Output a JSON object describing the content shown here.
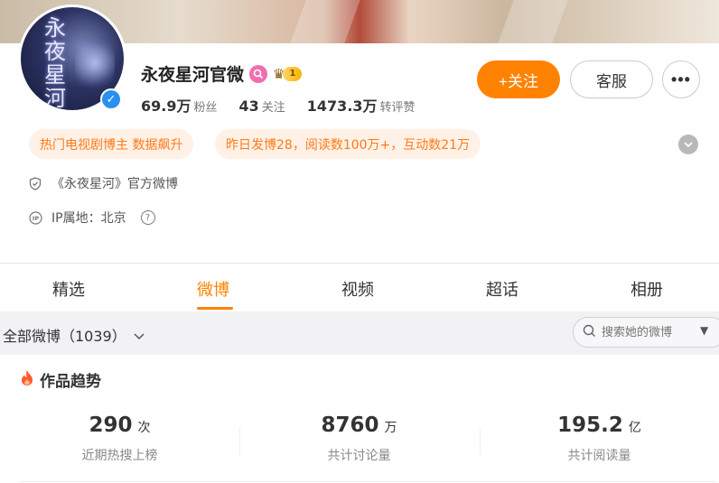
{
  "profile": {
    "name": "永夜星河官微",
    "avatar_text": [
      "永",
      "夜",
      "星",
      "河"
    ],
    "vip_level": "1",
    "verified_mark": "✓"
  },
  "stats": [
    {
      "num": "69.9万",
      "label": "粉丝"
    },
    {
      "num": "43",
      "label": "关注"
    },
    {
      "num": "1473.3万",
      "label": "转评赞"
    }
  ],
  "actions": {
    "follow_label": "+关注",
    "service_label": "客服",
    "more_label": "•••"
  },
  "tags": [
    "热门电视剧博主 数据飙升",
    "昨日发博28，阅读数100万+，互动数21万"
  ],
  "info": {
    "description": "《永夜星河》官方微博",
    "ip_location": "IP属地：北京"
  },
  "tabs": [
    "精选",
    "微博",
    "视频",
    "超话",
    "相册"
  ],
  "active_tab": "微博",
  "filter": {
    "label": "全部微博（1039）",
    "search_placeholder": "搜索她的微博"
  },
  "trends": {
    "title": "作品趋势",
    "metrics": [
      {
        "value": "290",
        "unit": "次",
        "label": "近期热搜上榜"
      },
      {
        "value": "8760",
        "unit": "万",
        "label": "共计讨论量"
      },
      {
        "value": "195.2",
        "unit": "亿",
        "label": "共计阅读量"
      }
    ]
  },
  "colors": {
    "accent": "#ff8200",
    "tag_bg": "#fff1e6",
    "verified": "#2b8ff2"
  },
  "icons": {
    "shield": "shield-icon",
    "ip": "ip-icon",
    "help": "help-icon",
    "search": "search-icon",
    "fire": "fire-icon",
    "chevron": "chevron-down-icon"
  }
}
